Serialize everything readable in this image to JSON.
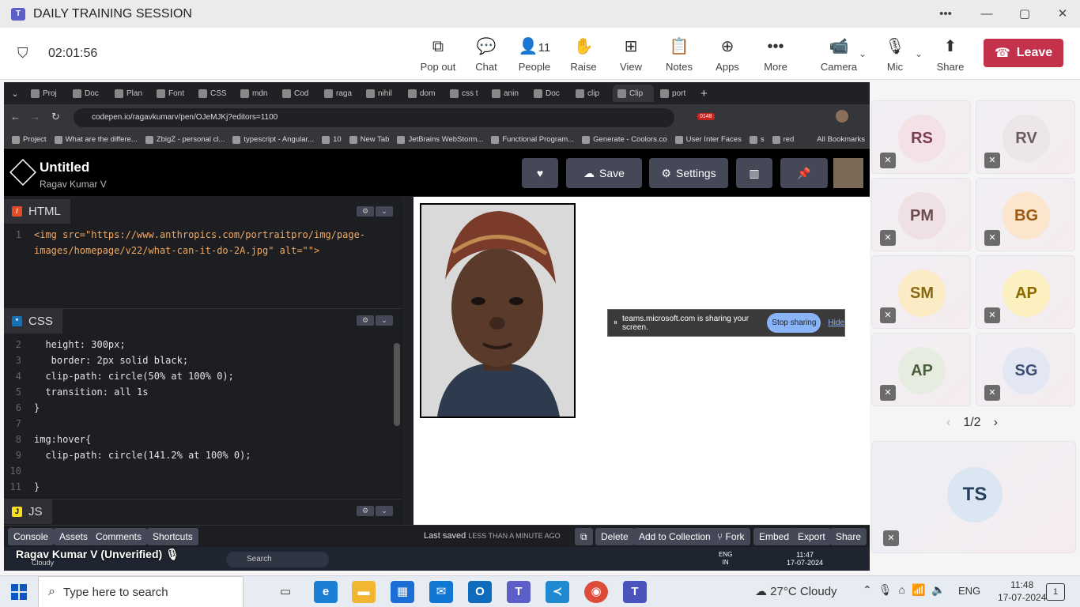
{
  "teams": {
    "title": "DAILY TRAINING SESSION",
    "timer": "02:01:56",
    "toolbar": {
      "popout": "Pop out",
      "chat": "Chat",
      "people": "People",
      "people_count": "11",
      "raise": "Raise",
      "view": "View",
      "notes": "Notes",
      "apps": "Apps",
      "more": "More",
      "camera": "Camera",
      "mic": "Mic",
      "share": "Share",
      "leave": "Leave"
    }
  },
  "browser": {
    "tabs": [
      "Proj",
      "Doc",
      "Plan",
      "Font",
      "CSS",
      "mdn",
      "Cod",
      "raga",
      "nihil",
      "dom",
      "css t",
      "anin",
      "Doc",
      "clip",
      "Clip",
      "port"
    ],
    "url": "codepen.io/ragavkumarv/pen/OJeMJKj?editors=1100",
    "badge": "0148",
    "bookmarks": [
      "Project",
      "What are the differe...",
      "ZbigZ - personal cl...",
      "typescript - Angular...",
      "10",
      "New Tab",
      "JetBrains WebStorm...",
      "Functional Program...",
      "Generate - Coolors.co",
      "User Inter Faces",
      "s",
      "red"
    ],
    "all_bookmarks": "All Bookmarks"
  },
  "codepen": {
    "title": "Untitled",
    "author": "Ragav Kumar V",
    "save": "Save",
    "settings": "Settings",
    "html_label": "HTML",
    "css_label": "CSS",
    "js_label": "JS",
    "html_lines": [
      {
        "n": "1",
        "code": "<img src=\"https://www.anthropics.com/portraitpro/img/page-"
      },
      {
        "n": "",
        "code": "images/homepage/v22/what-can-it-do-2A.jpg\" alt=\"\">"
      }
    ],
    "css_lines": [
      {
        "n": "2",
        "code": "  height: 300px;"
      },
      {
        "n": "3",
        "code": "   border: 2px solid black;"
      },
      {
        "n": "4",
        "code": "  clip-path: circle(50% at 100% 0);"
      },
      {
        "n": "5",
        "code": "  transition: all 1s"
      },
      {
        "n": "6",
        "code": "}"
      },
      {
        "n": "7",
        "code": ""
      },
      {
        "n": "8",
        "code": "img:hover{"
      },
      {
        "n": "9",
        "code": "  clip-path: circle(141.2% at 100% 0);"
      },
      {
        "n": "10",
        "code": ""
      },
      {
        "n": "11",
        "code": "}"
      }
    ],
    "footer": {
      "console": "Console",
      "assets": "Assets",
      "comments": "Comments",
      "shortcuts": "Shortcuts",
      "last_saved": "Last saved",
      "last_saved_when": "LESS THAN A MINUTE AGO",
      "delete": "Delete",
      "add_to_collection": "Add to Collection",
      "fork": "Fork",
      "embed": "Embed",
      "export": "Export",
      "share": "Share"
    }
  },
  "share_bar": {
    "text": "teams.microsoft.com is sharing your screen.",
    "stop": "Stop sharing",
    "hide": "Hide"
  },
  "presenter": "Ragav Kumar V (Unverified)",
  "mini_taskbar": {
    "search": "Search",
    "lang1": "ENG",
    "lang2": "IN",
    "time": "11:47",
    "date": "17-07-2024",
    "weather": "Cloudy"
  },
  "participants": [
    {
      "initials": "RS",
      "bg": "#f3e1e6",
      "fg": "#7a3b4e"
    },
    {
      "initials": "RV",
      "bg": "#ece6e8",
      "fg": "#6b5a5e"
    },
    {
      "initials": "PM",
      "bg": "#efe0e3",
      "fg": "#6e4a52"
    },
    {
      "initials": "BG",
      "bg": "#fbe5cd",
      "fg": "#9a5a12"
    },
    {
      "initials": "SM",
      "bg": "#fbecc5",
      "fg": "#8a6a10"
    },
    {
      "initials": "AP",
      "bg": "#fdf0c0",
      "fg": "#8a6a00"
    },
    {
      "initials": "AP",
      "bg": "#e6ece0",
      "fg": "#4a5e3c"
    },
    {
      "initials": "SG",
      "bg": "#e3e7f3",
      "fg": "#3c4e72"
    }
  ],
  "gallery_page": "1/2",
  "featured": {
    "initials": "TS"
  },
  "windows_taskbar": {
    "search_placeholder": "Type here to search",
    "weather": "27°C  Cloudy",
    "lang": "ENG",
    "time": "11:48",
    "date": "17-07-2024",
    "notif": "1"
  }
}
